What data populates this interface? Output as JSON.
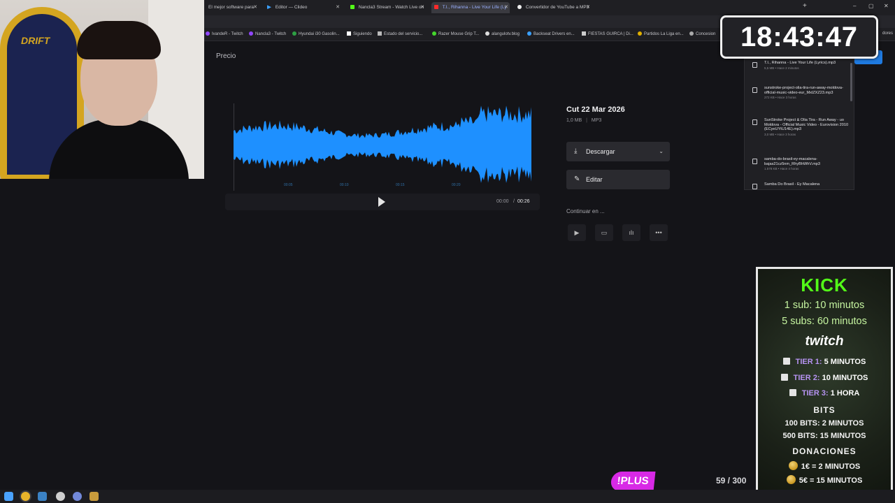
{
  "browser": {
    "tabs": [
      {
        "label": "El mejor software para",
        "fav": "#cccccc"
      },
      {
        "label": "Editor — Clideo",
        "fav": "#3aa0ff"
      },
      {
        "label": "Nancla3 Stream - Watch Live on",
        "fav": "#53fc18"
      },
      {
        "label": "T.I., Rihanna - Live Your Life (Ly",
        "fav": "#ff2a2a",
        "active": true
      },
      {
        "label": "Convertidor de YouTube a MP3",
        "fav": "#eeeeee"
      }
    ],
    "new_tab": "+",
    "window_controls": [
      "–",
      "▢",
      "✕"
    ],
    "bookmarks": [
      {
        "label": "IvandeR - Twitch",
        "color": "#9146ff"
      },
      {
        "label": "Nancla3 - Twitch",
        "color": "#9146ff"
      },
      {
        "label": "Hyundai i30 Gasolin...",
        "color": "#2ea043"
      },
      {
        "label": "Siguiendo",
        "color": "#ffffff"
      },
      {
        "label": "Estado del servicio...",
        "color": "#bbbbbb"
      },
      {
        "label": "Razer Mouse Grip T...",
        "color": "#44d62c"
      },
      {
        "label": "alangulotv.blog",
        "color": "#dddddd"
      },
      {
        "label": "Backseat Drivers en...",
        "color": "#3aa0ff"
      },
      {
        "label": "FIESTAS GUIRCA | Di...",
        "color": "#cccccc"
      },
      {
        "label": "Partidos La Liga en...",
        "color": "#e0b000"
      },
      {
        "label": "Concesion",
        "color": "#aaaaaa"
      }
    ],
    "bookmarks_tail": "dores"
  },
  "webcam": {
    "chair_label": "DRIFT"
  },
  "page": {
    "section_title": "Precio",
    "file_title": "Cut 22 Mar 2026",
    "file_size": "1,0 MB",
    "file_format": "MP3",
    "download_label": "Descargar",
    "edit_label": "Editar",
    "continue_label": "Continuar en ...",
    "time_current": "00:00",
    "time_separator": "/",
    "time_total": "00:26",
    "wave_ticks": [
      "00:05",
      "00:10",
      "00:15",
      "00:20"
    ],
    "wave_color": "#1e90ff"
  },
  "downloads": [
    {
      "name": "T.I., Rihanna - Live Your Life (Lyrics).mp3",
      "sub": "5,5 MB • Hace 2 minutos"
    },
    {
      "name": "sunstroke-project-olia-tira-run-away-moldova-official-music-video-eur_MxlZXZ23.mp3",
      "sub": "272 KB • Hace 3 horas"
    },
    {
      "name": "SunStroke Project & Olia Tira - Run Away - uo Moldova - Official Music Video - Eurovision 2010 (ECyeUYtU14E).mp3",
      "sub": "3,0 MB • Hace 3 horas"
    },
    {
      "name": "samba-do-brasil-ey-macalena-bajas21cz5nm_RhyBhWhV.mp3",
      "sub": "1.578 KB • Hace 4 horas"
    },
    {
      "name": "Samba Do Brasil - Ey Macalena",
      "sub": ""
    }
  ],
  "clock": "18:43:47",
  "subathon": {
    "kick_title": "KICK",
    "kick_lines": [
      "1 sub: 10 minutos",
      "5 subs: 60 minutos"
    ],
    "twitch_title": "twitch",
    "tiers": [
      {
        "tier": "TIER 1:",
        "value": "5 MINUTOS"
      },
      {
        "tier": "TIER 2:",
        "value": "10 MINUTOS"
      },
      {
        "tier": "TIER 3:",
        "value": "1 HORA"
      }
    ],
    "bits_title": "BITS",
    "bits_lines": [
      "100 BITS: 2 MINUTOS",
      "500 BITS: 15 MINUTOS"
    ],
    "donations_title": "DONACIONES",
    "donation_lines": [
      "1€ = 2 MINUTOS",
      "5€ = 15 MINUTOS"
    ]
  },
  "overlay": {
    "plus_label": "!PLUS",
    "progress_text": "59 / 300",
    "progress_value": 59,
    "progress_max": 300
  },
  "taskbar": {
    "icons": [
      {
        "name": "windows-start-icon",
        "color": "#4aa3ff"
      },
      {
        "name": "chrome-icon",
        "color": "#e8b32a"
      },
      {
        "name": "steam-icon",
        "color": "#3b82c4"
      },
      {
        "name": "obs-icon",
        "color": "#cfcfcf"
      },
      {
        "name": "discord-icon",
        "color": "#7289da"
      },
      {
        "name": "league-icon",
        "color": "#c89b3c"
      }
    ]
  }
}
